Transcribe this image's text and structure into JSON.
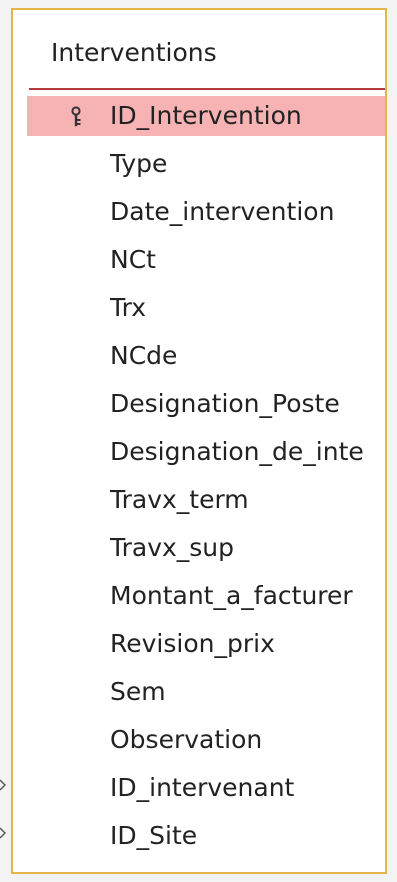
{
  "table": {
    "title": "Interventions",
    "fields": [
      {
        "label": "ID_Intervention",
        "primary_key": true,
        "selected": true
      },
      {
        "label": "Type"
      },
      {
        "label": "Date_intervention"
      },
      {
        "label": "NCt"
      },
      {
        "label": "Trx"
      },
      {
        "label": "NCde"
      },
      {
        "label": "Designation_Poste"
      },
      {
        "label": "Designation_de_inte"
      },
      {
        "label": "Travx_term"
      },
      {
        "label": "Travx_sup"
      },
      {
        "label": "Montant_a_facturer"
      },
      {
        "label": "Revision_prix"
      },
      {
        "label": "Sem"
      },
      {
        "label": "Observation"
      },
      {
        "label": "ID_intervenant"
      },
      {
        "label": "ID_Site"
      }
    ]
  },
  "colors": {
    "border": "#e3b64a",
    "title_separator": "#b23b3b",
    "selection": "#f7b3b3",
    "text": "#222222"
  },
  "icons": {
    "primary_key": "key-icon"
  }
}
